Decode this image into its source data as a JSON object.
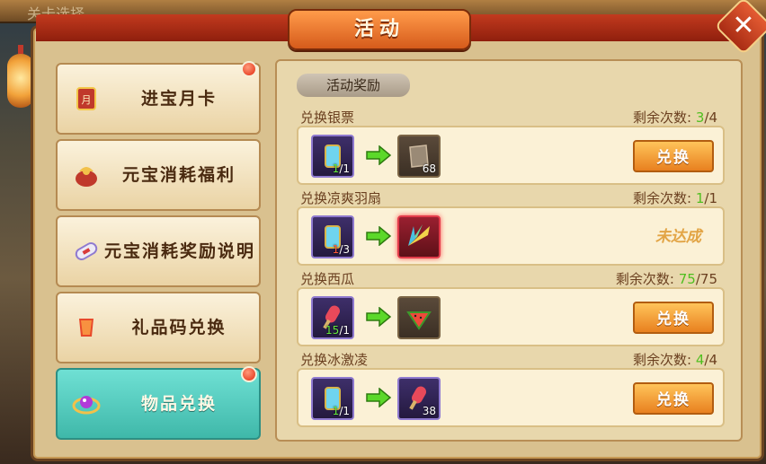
{
  "background": {
    "title": "关卡选择"
  },
  "header": {
    "title": "活动",
    "close_label": "✕"
  },
  "tabs": [
    {
      "label": "进宝月卡",
      "icon": "month-card-icon",
      "dot": true,
      "active": false
    },
    {
      "label": "元宝消耗福利",
      "icon": "gift-bag-icon",
      "dot": false,
      "active": false
    },
    {
      "label": "元宝消耗奖励说明",
      "icon": "scroll-icon",
      "dot": false,
      "active": false
    },
    {
      "label": "礼品码兑换",
      "icon": "sky-lantern-icon",
      "dot": false,
      "active": false
    },
    {
      "label": "物品兑换",
      "icon": "jewel-ring-icon",
      "dot": true,
      "active": true
    }
  ],
  "section_tag": "活动奖励",
  "count_prefix": "剩余次数:",
  "rows": [
    {
      "title": "兑换银票",
      "count_current": "3",
      "count_total": "/4",
      "input": {
        "icon": "ice-scroll-icon",
        "qty_have": "1",
        "qty_need": "/1"
      },
      "output": {
        "icon": "silver-note-icon",
        "qty": "68"
      },
      "action": "兑换"
    },
    {
      "title": "兑换凉爽羽扇",
      "count_current": "1",
      "count_total": "/1",
      "input": {
        "icon": "ice-scroll-icon",
        "qty_have": "1",
        "qty_need": "/3"
      },
      "output": {
        "icon": "feather-fan-icon",
        "qty": ""
      },
      "action": "未达成"
    },
    {
      "title": "兑换西瓜",
      "count_current": "75",
      "count_total": "/75",
      "input": {
        "icon": "popsicle-icon",
        "qty_have": "15",
        "qty_need": "/1"
      },
      "output": {
        "icon": "watermelon-icon",
        "qty": ""
      },
      "action": "兑换"
    },
    {
      "title": "兑换冰激凌",
      "count_current": "4",
      "count_total": "/4",
      "input": {
        "icon": "ice-scroll-icon",
        "qty_have": "1",
        "qty_need": "/1"
      },
      "output": {
        "icon": "popsicle-icon",
        "qty": "38"
      },
      "action": "兑换"
    }
  ],
  "colors": {
    "accent": "#e8801f",
    "active_tab": "#3fb8a9",
    "count_green": "#4fbf1f"
  }
}
